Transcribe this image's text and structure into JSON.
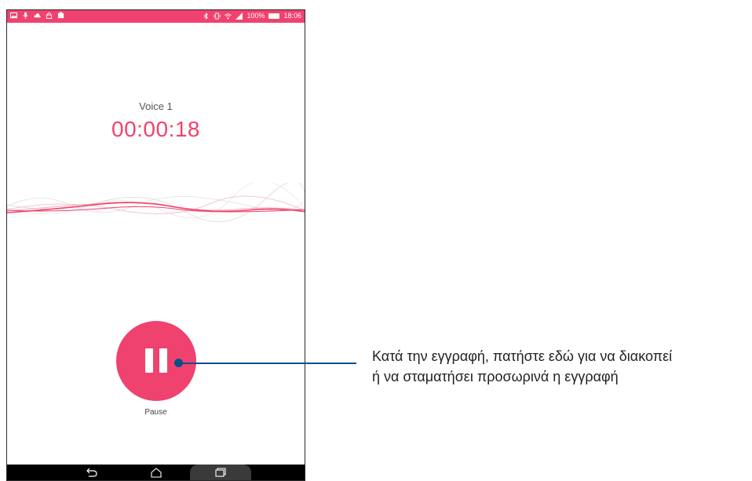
{
  "status_bar": {
    "left_icons": [
      "image-icon",
      "mic-icon",
      "cloud-icon",
      "lock-icon",
      "app-icon"
    ],
    "battery_percent": "100%",
    "time": "18:06"
  },
  "recording": {
    "title": "Voice 1",
    "elapsed": "00:00:18"
  },
  "controls": {
    "pause_label": "Pause"
  },
  "navbar": {
    "buttons": [
      "back-icon",
      "home-icon",
      "recent-apps-icon"
    ]
  },
  "callout": {
    "line1": "Κατά την εγγραφή, πατήστε εδώ για να διακοπεί",
    "line2": "ή να σταματήσει προσωρινά η εγγραφή"
  },
  "colors": {
    "accent": "#f0426e",
    "callout_line": "#0b4f8a",
    "navbar": "#000000"
  }
}
